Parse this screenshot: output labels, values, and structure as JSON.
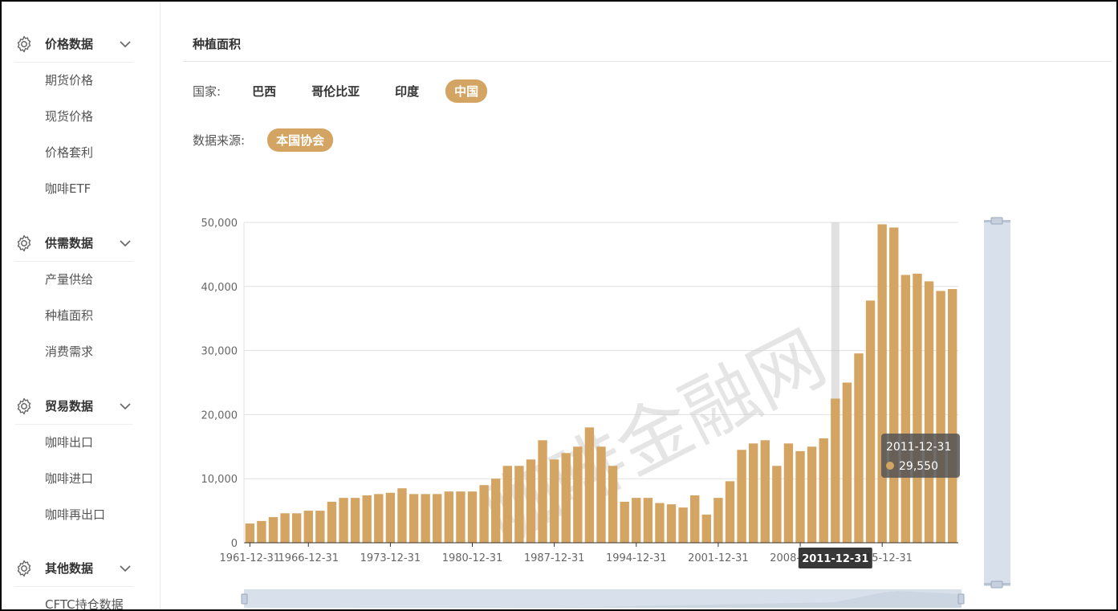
{
  "sidebar": {
    "groups": [
      {
        "title": "价格数据",
        "icon": "gear-icon",
        "items": [
          "期货价格",
          "现货价格",
          "价格套利",
          "咖啡ETF"
        ]
      },
      {
        "title": "供需数据",
        "icon": "gear-icon",
        "items": [
          "产量供给",
          "种植面积",
          "消费需求"
        ]
      },
      {
        "title": "贸易数据",
        "icon": "gear-icon",
        "items": [
          "咖啡出口",
          "咖啡进口",
          "咖啡再出口"
        ]
      },
      {
        "title": "其他数据",
        "icon": "gear-icon",
        "items": [
          "CFTC持仓数据"
        ]
      }
    ]
  },
  "main": {
    "title": "种植面积",
    "country": {
      "label": "国家:",
      "options": [
        "巴西",
        "哥伦比亚",
        "印度",
        "中国"
      ],
      "selected": "中国"
    },
    "source": {
      "label": "数据来源:",
      "options": [
        "本国协会"
      ],
      "selected": "本国协会"
    }
  },
  "watermark": "咖啡金融网",
  "tooltip": {
    "date": "2011-12-31",
    "value": "29,550"
  },
  "axis_pointer_label": "2011-12-31",
  "colors": {
    "accent": "#d4a462",
    "slider": "#d8e0eb",
    "grid": "#e0e0e0"
  },
  "chart_data": {
    "type": "bar",
    "x": [
      "1961-12-31",
      "1962-12-31",
      "1963-12-31",
      "1964-12-31",
      "1965-12-31",
      "1966-12-31",
      "1967-12-31",
      "1968-12-31",
      "1969-12-31",
      "1970-12-31",
      "1971-12-31",
      "1972-12-31",
      "1973-12-31",
      "1974-12-31",
      "1975-12-31",
      "1976-12-31",
      "1977-12-31",
      "1978-12-31",
      "1979-12-31",
      "1980-12-31",
      "1981-12-31",
      "1982-12-31",
      "1983-12-31",
      "1984-12-31",
      "1985-12-31",
      "1986-12-31",
      "1987-12-31",
      "1988-12-31",
      "1989-12-31",
      "1990-12-31",
      "1991-12-31",
      "1992-12-31",
      "1993-12-31",
      "1994-12-31",
      "1995-12-31",
      "1996-12-31",
      "1997-12-31",
      "1998-12-31",
      "1999-12-31",
      "2000-12-31",
      "2001-12-31",
      "2002-12-31",
      "2003-12-31",
      "2004-12-31",
      "2005-12-31",
      "2006-12-31",
      "2007-12-31",
      "2008-12-31",
      "2009-12-31",
      "2010-12-31",
      "2011-12-31",
      "2012-12-31",
      "2013-12-31",
      "2014-12-31",
      "2015-12-31",
      "2016-12-31",
      "2017-12-31",
      "2018-12-31",
      "2019-12-31",
      "2020-12-31",
      "2021-12-31"
    ],
    "values": [
      3000,
      3400,
      4000,
      4600,
      4600,
      5000,
      5000,
      6400,
      7000,
      7000,
      7400,
      7600,
      7800,
      8500,
      7600,
      7600,
      7600,
      8000,
      8000,
      8000,
      9000,
      10000,
      12000,
      12000,
      13000,
      16000,
      13000,
      14000,
      15000,
      18000,
      15000,
      12000,
      6400,
      7000,
      7000,
      6200,
      6000,
      5500,
      7400,
      4400,
      7000,
      9600,
      14500,
      15500,
      16000,
      12000,
      15500,
      14300,
      15000,
      16300,
      22500,
      25000,
      29550,
      37800,
      49700,
      49200,
      41800,
      42000,
      40800,
      39300,
      39600
    ],
    "x_tick_labels": [
      "1961-12-31",
      "1966-12-31",
      "1973-12-31",
      "1980-12-31",
      "1987-12-31",
      "1994-12-31",
      "2001-12-31",
      "2008-12-31",
      "2015-12-31"
    ],
    "y_tick_labels": [
      "0",
      "10,000",
      "20,000",
      "30,000",
      "40,000",
      "50,000"
    ],
    "ylim": [
      0,
      50000
    ],
    "grid": true,
    "highlighted": "2011-12-31"
  }
}
